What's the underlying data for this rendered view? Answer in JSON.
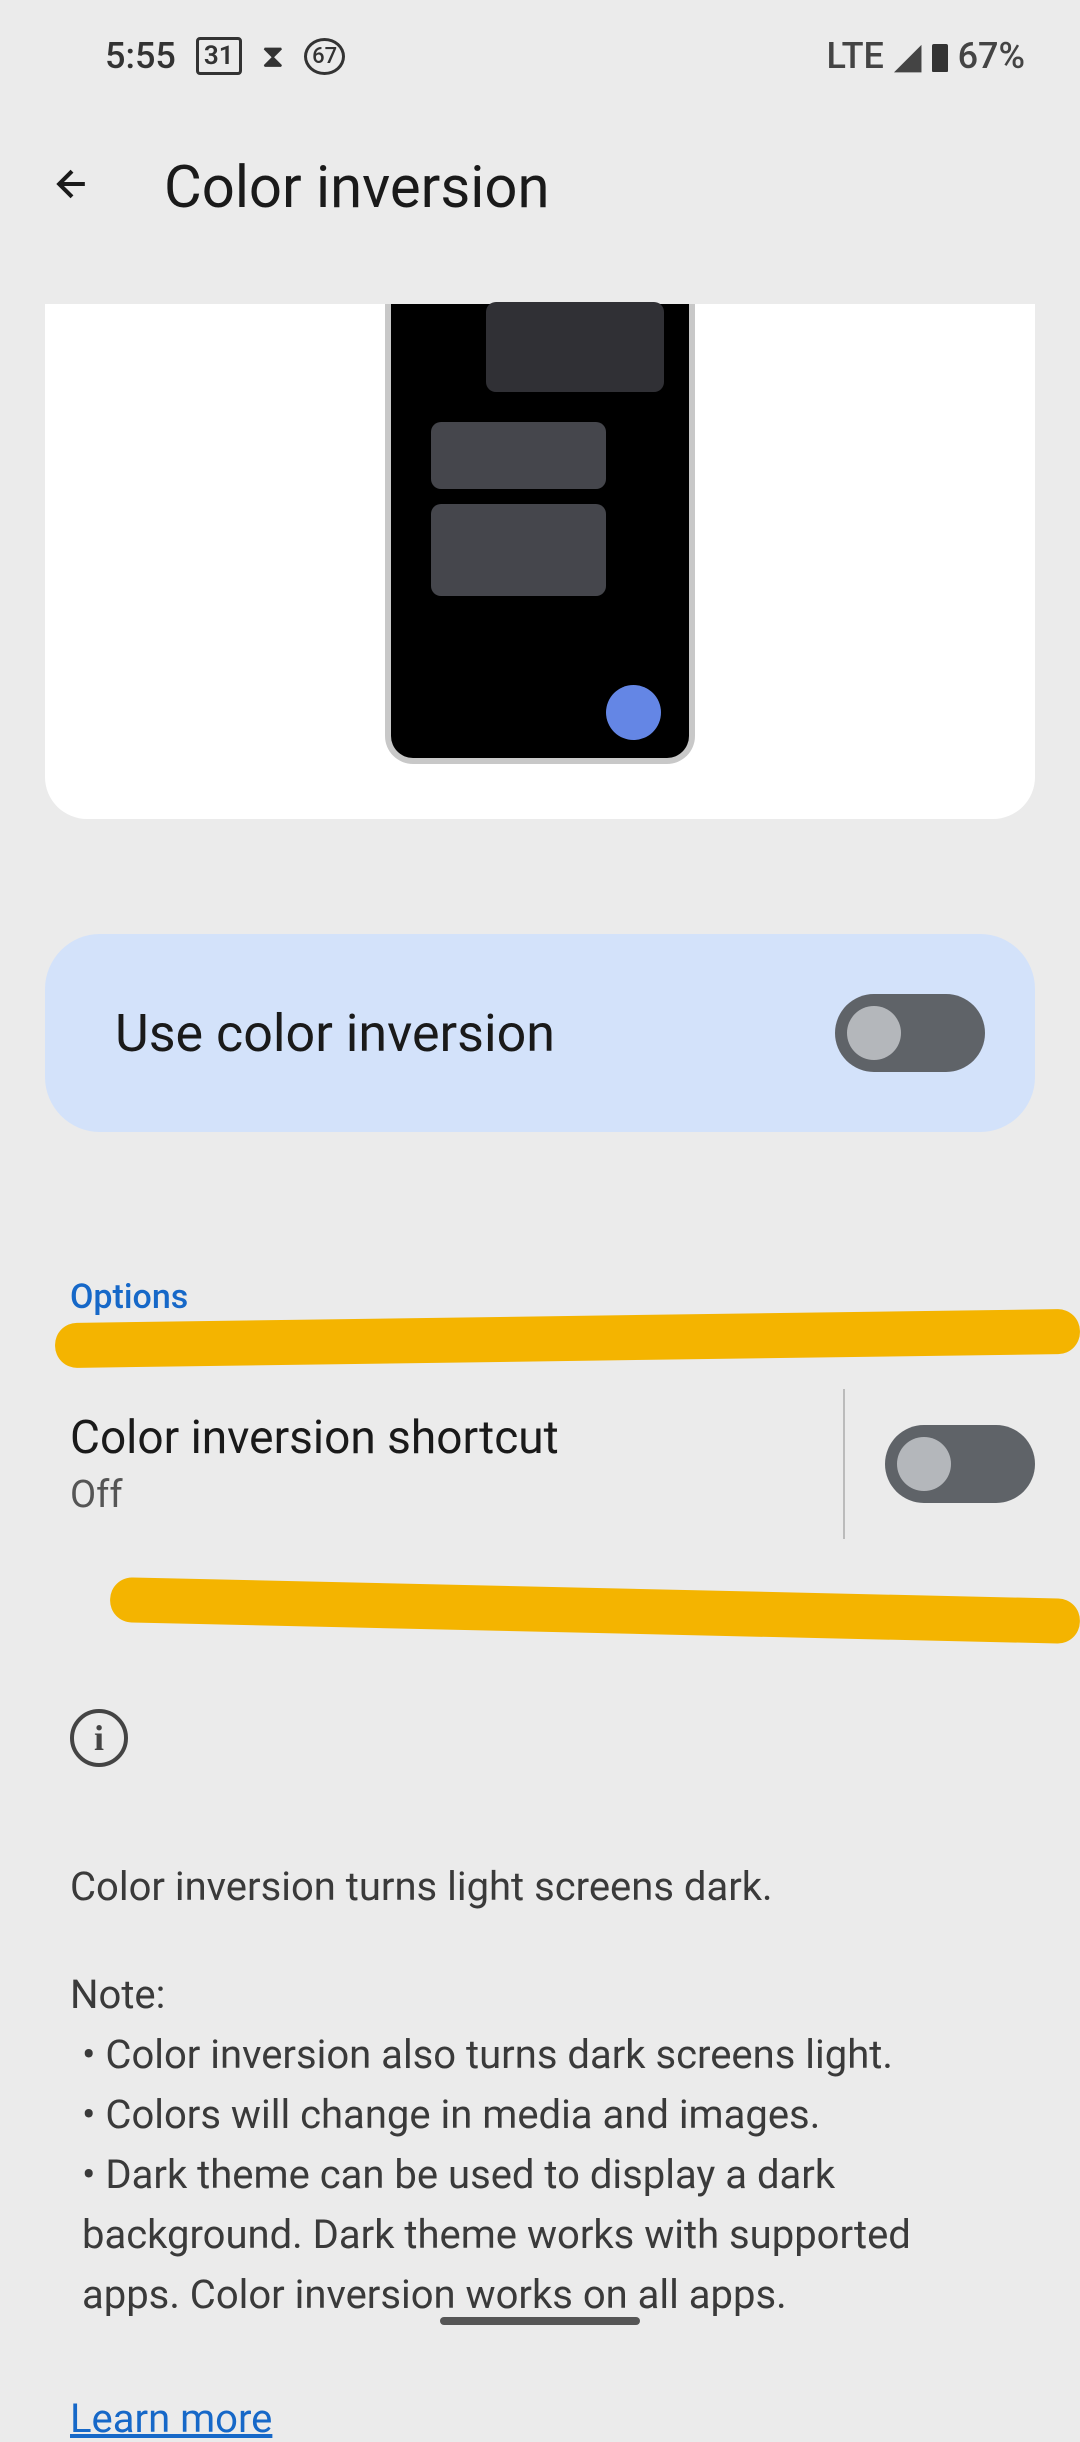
{
  "status_bar": {
    "time": "5:55",
    "calendar_badge": "31",
    "network": "LTE",
    "battery": "67%",
    "battery_circle": "67"
  },
  "header": {
    "title": "Color inversion"
  },
  "main_toggle": {
    "label": "Use color inversion",
    "state": "off"
  },
  "options": {
    "section_label": "Options",
    "shortcut": {
      "title": "Color inversion shortcut",
      "status": "Off",
      "state": "off"
    }
  },
  "info": {
    "line1": "Color inversion turns light screens dark.",
    "note_label": "Note:",
    "bullet1": "• Color inversion also turns dark screens light.",
    "bullet2": "• Colors will change in media and images.",
    "bullet3": "• Dark theme can be used to display a dark background. Dark theme works with supported apps. Color inversion works on all apps.",
    "learn_more": "Learn more"
  }
}
